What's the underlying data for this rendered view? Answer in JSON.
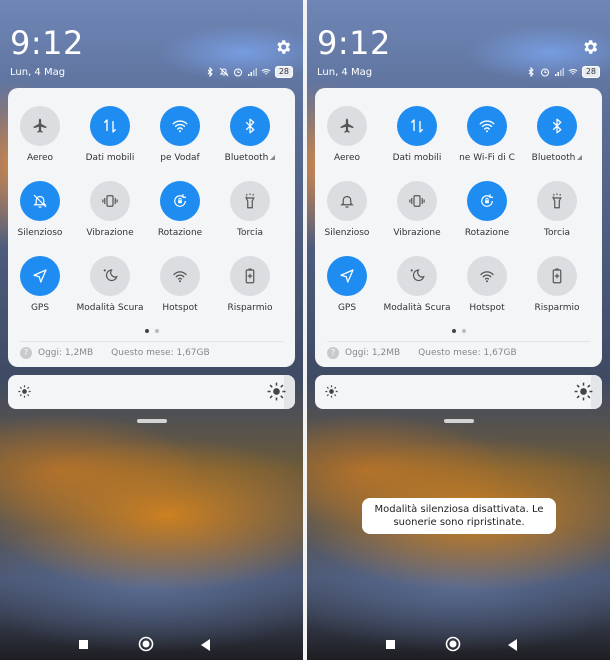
{
  "colors": {
    "accent": "#1e8cf0",
    "tile_off": "#dcdde0",
    "panel": "#f4f5f7"
  },
  "screens": [
    {
      "time": "9:12",
      "date": "Lun, 4 Mag",
      "battery": "28",
      "tiles": [
        {
          "label": "Aereo",
          "icon": "airplane-icon",
          "on": false
        },
        {
          "label": "Dati mobili",
          "icon": "mobile-data-icon",
          "on": true
        },
        {
          "label": "Vodafone Wi-Fi di Casa",
          "visible_label": "pe    Vodaf",
          "icon": "wifi-icon",
          "on": true
        },
        {
          "label": "Bluetooth",
          "icon": "bluetooth-icon",
          "on": true
        },
        {
          "label": "Silenzioso",
          "icon": "bell-off-icon",
          "on": true
        },
        {
          "label": "Vibrazione",
          "icon": "vibrate-icon",
          "on": false
        },
        {
          "label": "Rotazione",
          "icon": "rotation-lock-icon",
          "on": true
        },
        {
          "label": "Torcia",
          "icon": "flashlight-icon",
          "on": false
        },
        {
          "label": "GPS",
          "icon": "gps-icon",
          "on": true
        },
        {
          "label": "Modalità Scura",
          "icon": "dark-mode-icon",
          "on": false
        },
        {
          "label": "Hotspot",
          "icon": "hotspot-icon",
          "on": false
        },
        {
          "label": "Risparmio",
          "icon": "battery-saver-icon",
          "on": false
        }
      ],
      "data_usage": {
        "today": "Oggi: 1,2MB",
        "month": "Questo mese: 1,67GB"
      },
      "brightness_level": 0.96
    },
    {
      "time": "9:12",
      "date": "Lun, 4 Mag",
      "battery": "28",
      "tiles": [
        {
          "label": "Aereo",
          "icon": "airplane-icon",
          "on": false
        },
        {
          "label": "Dati mobili",
          "icon": "mobile-data-icon",
          "on": true
        },
        {
          "label": "ne Wi-Fi di C",
          "icon": "wifi-icon",
          "on": true
        },
        {
          "label": "Bluetooth",
          "icon": "bluetooth-icon",
          "on": true
        },
        {
          "label": "Silenzioso",
          "icon": "bell-icon",
          "on": false
        },
        {
          "label": "Vibrazione",
          "icon": "vibrate-icon",
          "on": false
        },
        {
          "label": "Rotazione",
          "icon": "rotation-lock-icon",
          "on": true
        },
        {
          "label": "Torcia",
          "icon": "flashlight-icon",
          "on": false
        },
        {
          "label": "GPS",
          "icon": "gps-icon",
          "on": true
        },
        {
          "label": "Modalità Scura",
          "icon": "dark-mode-icon",
          "on": false
        },
        {
          "label": "Hotspot",
          "icon": "hotspot-icon",
          "on": false
        },
        {
          "label": "Risparmio",
          "icon": "battery-saver-icon",
          "on": false
        }
      ],
      "data_usage": {
        "today": "Oggi: 1,2MB",
        "month": "Questo mese: 1,67GB"
      },
      "brightness_level": 0.96,
      "toast": "Modalità silenziosa disattivata. Le suonerie sono ripristinate."
    }
  ]
}
